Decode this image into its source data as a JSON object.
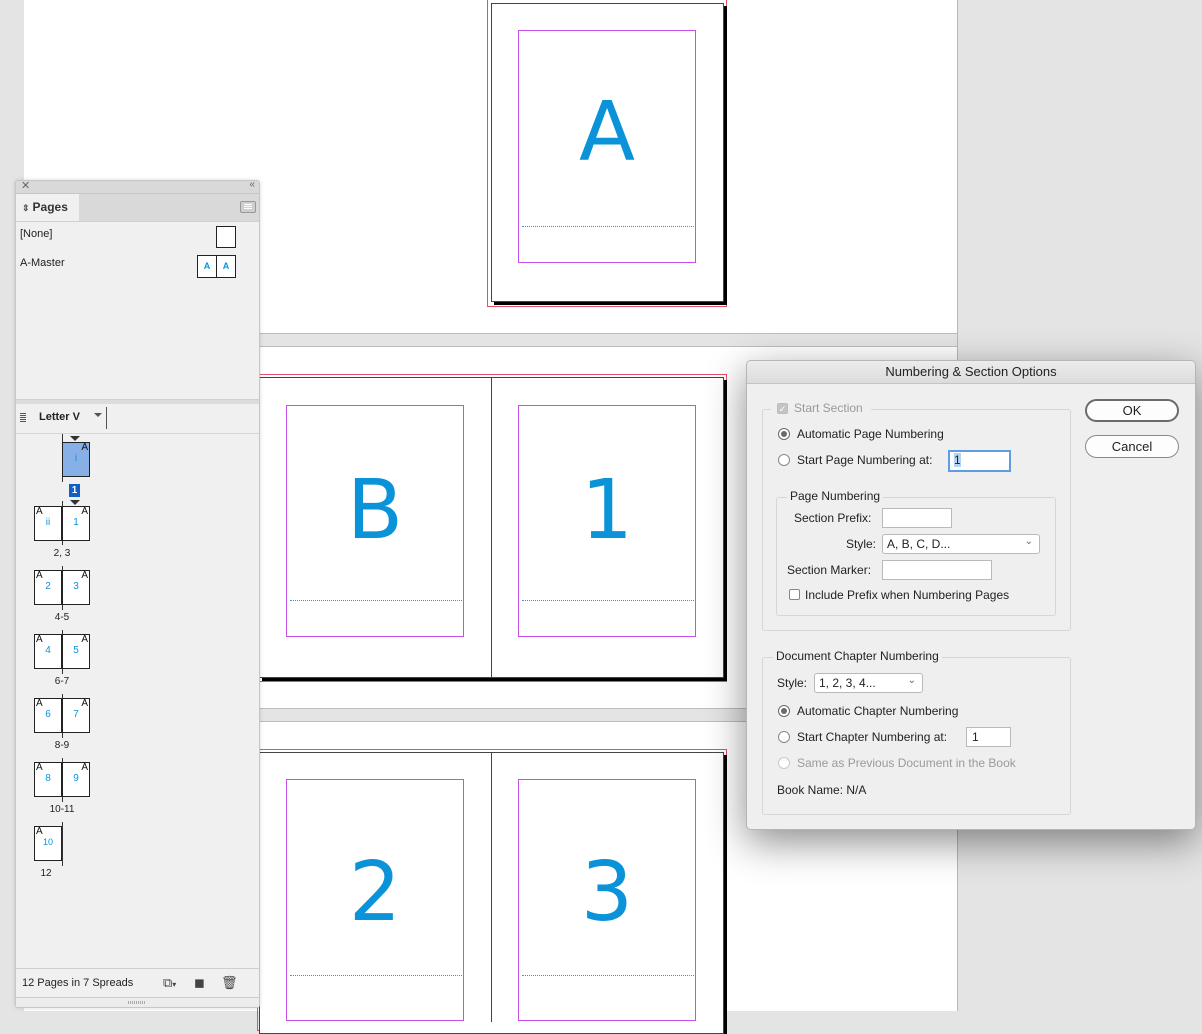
{
  "document": {
    "master_page_glyph": "A",
    "spread_2": {
      "left": "B",
      "right": "1"
    },
    "spread_3": {
      "left": "2",
      "right": "3"
    }
  },
  "colors": {
    "glyph_blue": "#0a93d8",
    "bleed_red": "#e3506a",
    "margin_purple": "#c84ee8",
    "selection_blue": "#1060c8"
  },
  "pages_panel": {
    "tab_label": "Pages",
    "masters": [
      {
        "label": "[None]",
        "thumbs": []
      },
      {
        "label": "A-Master",
        "thumbs": [
          "A",
          "A"
        ]
      }
    ],
    "page_size": "Letter V",
    "spreads": [
      {
        "pages": [
          {
            "master": "A",
            "number": "i",
            "selected": true
          }
        ],
        "label": "1",
        "label_selected": true
      },
      {
        "pages": [
          {
            "master": "A",
            "number": "ii"
          },
          {
            "master": "A",
            "number": "1"
          }
        ],
        "label": "2, 3"
      },
      {
        "pages": [
          {
            "master": "A",
            "number": "2"
          },
          {
            "master": "A",
            "number": "3"
          }
        ],
        "label": "4-5"
      },
      {
        "pages": [
          {
            "master": "A",
            "number": "4"
          },
          {
            "master": "A",
            "number": "5"
          }
        ],
        "label": "6-7"
      },
      {
        "pages": [
          {
            "master": "A",
            "number": "6"
          },
          {
            "master": "A",
            "number": "7"
          }
        ],
        "label": "8-9"
      },
      {
        "pages": [
          {
            "master": "A",
            "number": "8"
          },
          {
            "master": "A",
            "number": "9"
          }
        ],
        "label": "10-11"
      },
      {
        "pages": [
          {
            "master": "A",
            "number": "10"
          }
        ],
        "label": "12"
      }
    ],
    "status": "12 Pages in 7 Spreads",
    "footer_icons": [
      "edit-page-size-icon",
      "new-page-icon",
      "trash-icon"
    ]
  },
  "dialog": {
    "title": "Numbering & Section Options",
    "ok_label": "OK",
    "cancel_label": "Cancel",
    "start_section": {
      "label": "Start Section",
      "checked": true,
      "disabled": true
    },
    "automatic_page_numbering": {
      "label": "Automatic Page Numbering",
      "selected": true
    },
    "start_page_numbering": {
      "label": "Start Page Numbering at:",
      "value": "1",
      "selected": false
    },
    "page_numbering": {
      "legend": "Page Numbering",
      "section_prefix_label": "Section Prefix:",
      "section_prefix_value": "",
      "style_label": "Style:",
      "style_value": "A, B, C, D...",
      "section_marker_label": "Section Marker:",
      "section_marker_value": "",
      "include_prefix_label": "Include Prefix when Numbering Pages",
      "include_prefix_checked": false
    },
    "chapter_numbering": {
      "legend": "Document Chapter Numbering",
      "style_label": "Style:",
      "style_value": "1, 2, 3, 4...",
      "automatic_label": "Automatic Chapter Numbering",
      "automatic_selected": true,
      "start_label": "Start Chapter Numbering at:",
      "start_value": "1",
      "same_as_previous_label": "Same as Previous Document in the Book",
      "book_name": "Book Name: N/A"
    }
  }
}
